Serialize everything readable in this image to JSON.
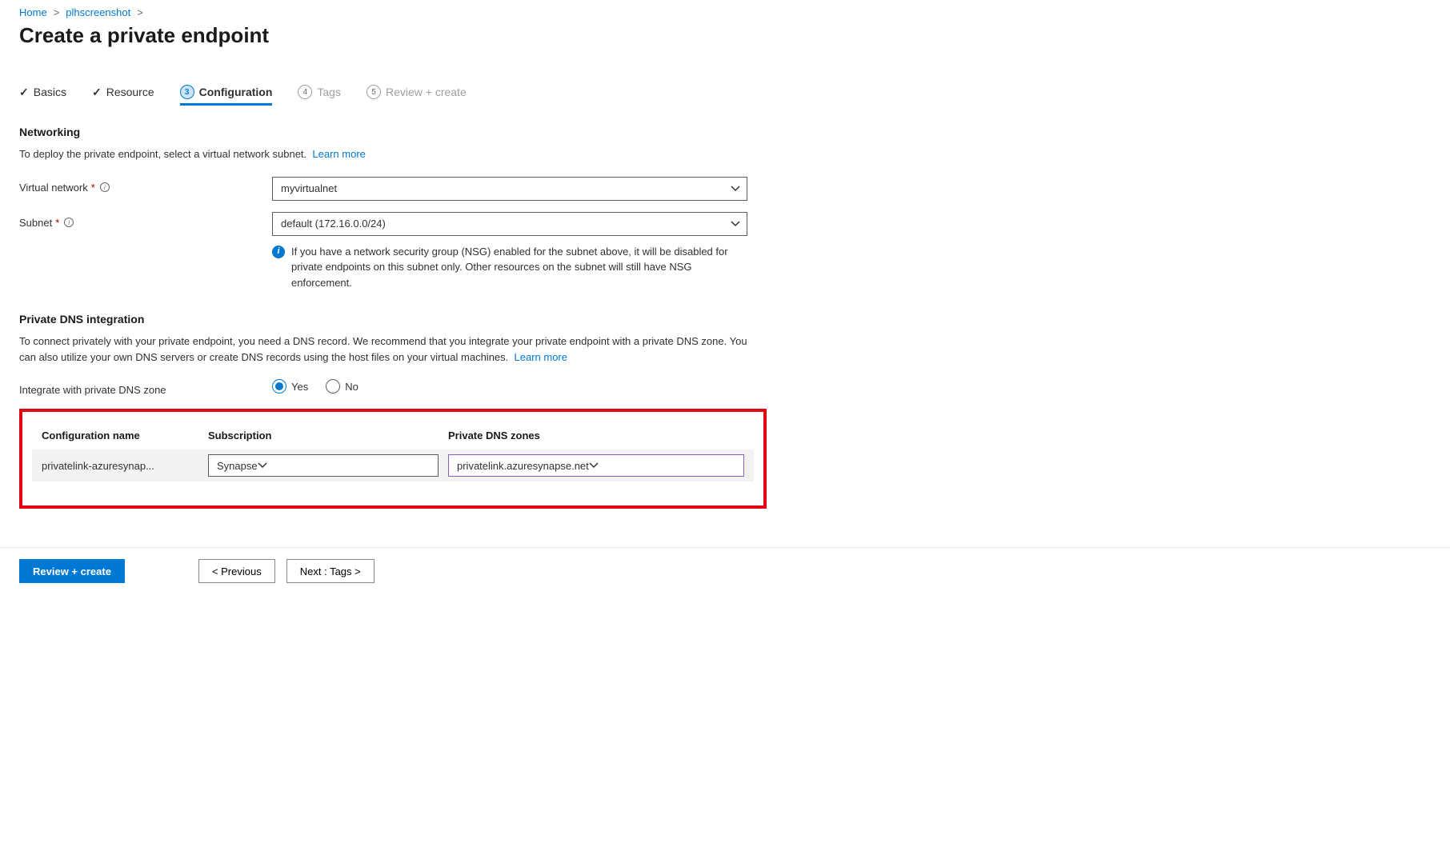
{
  "breadcrumb": {
    "home": "Home",
    "resource": "plhscreenshot"
  },
  "page_title": "Create a private endpoint",
  "tabs": {
    "basics": "Basics",
    "resource": "Resource",
    "configuration": {
      "num": "3",
      "label": "Configuration"
    },
    "tags": {
      "num": "4",
      "label": "Tags"
    },
    "review": {
      "num": "5",
      "label": "Review + create"
    }
  },
  "networking": {
    "heading": "Networking",
    "desc": "To deploy the private endpoint, select a virtual network subnet.",
    "learn_more": "Learn more",
    "vnet_label": "Virtual network",
    "vnet_value": "myvirtualnet",
    "subnet_label": "Subnet",
    "subnet_value": "default (172.16.0.0/24)",
    "nsg_info": "If you have a network security group (NSG) enabled for the subnet above, it will be disabled for private endpoints on this subnet only. Other resources on the subnet will still have NSG enforcement."
  },
  "dns": {
    "heading": "Private DNS integration",
    "desc": "To connect privately with your private endpoint, you need a DNS record. We recommend that you integrate your private endpoint with a private DNS zone. You can also utilize your own DNS servers or create DNS records using the host files on your virtual machines.",
    "learn_more": "Learn more",
    "integrate_label": "Integrate with private DNS zone",
    "yes": "Yes",
    "no": "No",
    "table": {
      "col1": "Configuration name",
      "col2": "Subscription",
      "col3": "Private DNS zones",
      "rows": [
        {
          "config_name": "privatelink-azuresynap...",
          "subscription": "Synapse",
          "zone": "privatelink.azuresynapse.net"
        }
      ]
    }
  },
  "footer": {
    "review": "Review + create",
    "previous": "< Previous",
    "next": "Next : Tags >"
  }
}
